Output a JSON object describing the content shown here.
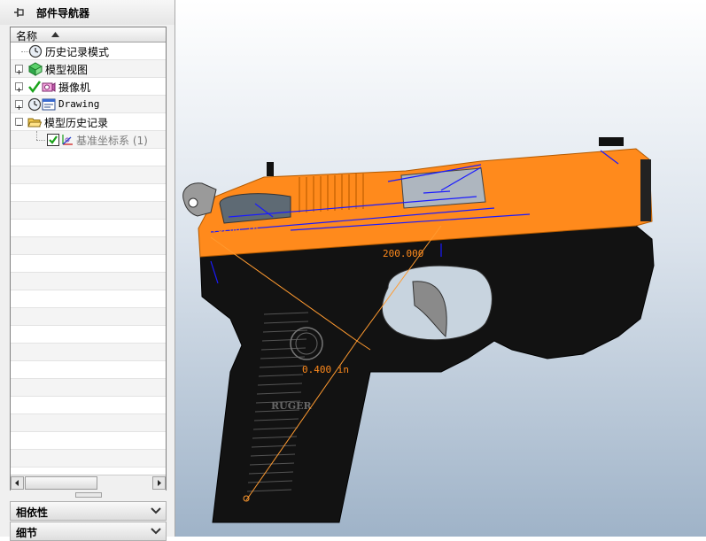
{
  "navigator": {
    "title": "部件导航器",
    "column_header": "名称",
    "items": [
      {
        "label": "历史记录模式",
        "icon": "clock-icon",
        "expandable": false
      },
      {
        "label": "模型视图",
        "icon": "model-views-icon",
        "expandable": true
      },
      {
        "label": "摄像机",
        "icon": "camera-icon",
        "expandable": true,
        "checked": true
      },
      {
        "label": "Drawing",
        "icon": "drawing-icon",
        "expandable": true
      },
      {
        "label": "模型历史记录",
        "icon": "folder-open-icon",
        "expandable": true,
        "expanded": true
      },
      {
        "label": "基准坐标系 (1)",
        "icon": "datum-csys-icon",
        "expandable": false,
        "checked": true,
        "grayed": true
      }
    ],
    "sections": [
      {
        "title": "相依性"
      },
      {
        "title": "细节"
      }
    ]
  },
  "viewport": {
    "dimensions": [
      {
        "text": "0.0200 in"
      },
      {
        "text": "200.000"
      },
      {
        "text": "0.400  in"
      }
    ],
    "engraving": "RUGER"
  },
  "colors": {
    "slide": "#ff8a1c",
    "frame": "#111111",
    "constraint": "#1a1aff",
    "dimension": "#ff8a1c",
    "trigger": "#8a8a8a"
  }
}
